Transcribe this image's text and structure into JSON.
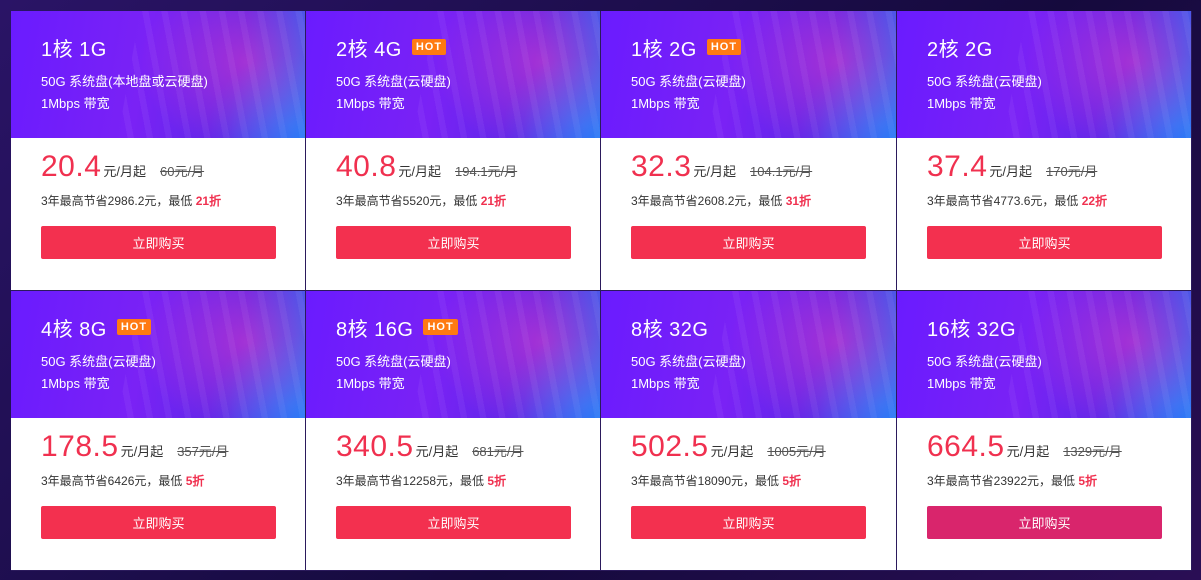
{
  "plans": [
    {
      "title": "1核 1G",
      "hot": "",
      "disk": "50G 系统盘(本地盘或云硬盘)",
      "bandwidth": "1Mbps 带宽",
      "price": "20.4",
      "unit": "元/月起",
      "orig": "60元/月",
      "save_text": "3年最高节省2986.2元，最低 ",
      "discount": "21折",
      "button": "立即购买"
    },
    {
      "title": "2核 4G",
      "hot": "HOT",
      "disk": "50G 系统盘(云硬盘)",
      "bandwidth": "1Mbps 带宽",
      "price": "40.8",
      "unit": "元/月起",
      "orig": "194.1元/月",
      "save_text": "3年最高节省5520元，最低 ",
      "discount": "21折",
      "button": "立即购买"
    },
    {
      "title": "1核 2G",
      "hot": "HOT",
      "disk": "50G 系统盘(云硬盘)",
      "bandwidth": "1Mbps 带宽",
      "price": "32.3",
      "unit": "元/月起",
      "orig": "104.1元/月",
      "save_text": "3年最高节省2608.2元，最低 ",
      "discount": "31折",
      "button": "立即购买"
    },
    {
      "title": "2核 2G",
      "hot": "",
      "disk": "50G 系统盘(云硬盘)",
      "bandwidth": "1Mbps 带宽",
      "price": "37.4",
      "unit": "元/月起",
      "orig": "170元/月",
      "save_text": "3年最高节省4773.6元，最低 ",
      "discount": "22折",
      "button": "立即购买"
    },
    {
      "title": "4核 8G",
      "hot": "HOT",
      "disk": "50G 系统盘(云硬盘)",
      "bandwidth": "1Mbps 带宽",
      "price": "178.5",
      "unit": "元/月起",
      "orig": "357元/月",
      "save_text": "3年最高节省6426元，最低 ",
      "discount": "5折",
      "button": "立即购买"
    },
    {
      "title": "8核 16G",
      "hot": "HOT",
      "disk": "50G 系统盘(云硬盘)",
      "bandwidth": "1Mbps 带宽",
      "price": "340.5",
      "unit": "元/月起",
      "orig": "681元/月",
      "save_text": "3年最高节省12258元，最低 ",
      "discount": "5折",
      "button": "立即购买"
    },
    {
      "title": "8核 32G",
      "hot": "",
      "disk": "50G 系统盘(云硬盘)",
      "bandwidth": "1Mbps 带宽",
      "price": "502.5",
      "unit": "元/月起",
      "orig": "1005元/月",
      "save_text": "3年最高节省18090元，最低 ",
      "discount": "5折",
      "button": "立即购买"
    },
    {
      "title": "16核 32G",
      "hot": "",
      "disk": "50G 系统盘(云硬盘)",
      "bandwidth": "1Mbps 带宽",
      "price": "664.5",
      "unit": "元/月起",
      "orig": "1329元/月",
      "save_text": "3年最高节省23922元，最低 ",
      "discount": "5折",
      "button": "立即购买"
    }
  ],
  "colors": {
    "accent": "#f3304f",
    "hot_badge": "#ff7a12",
    "hover_button": "#d9256c",
    "header_purple": "#6a1bff"
  }
}
